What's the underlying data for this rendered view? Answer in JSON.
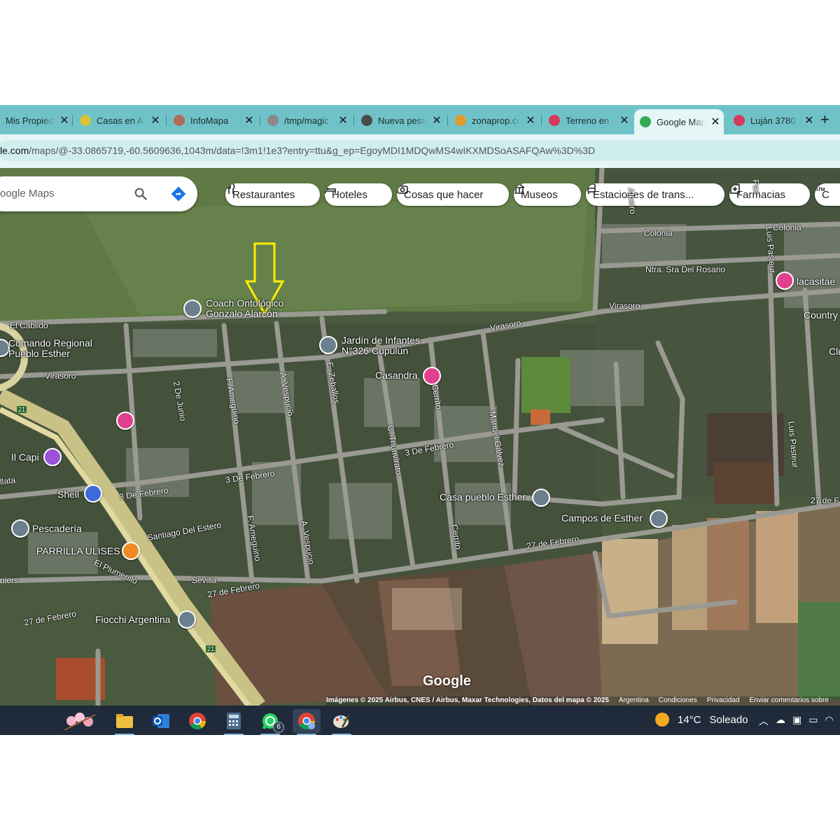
{
  "browser": {
    "tabs": [
      {
        "title": "Mis Propiedades",
        "favicon": "house-icon",
        "color": "#2a8a8f"
      },
      {
        "title": "Casas en Alquiler",
        "favicon": "home-icon",
        "color": "#d8c33a"
      },
      {
        "title": "InfoMapa",
        "favicon": "globe-icon",
        "color": "#b06a5a"
      },
      {
        "title": "/tmp/magic",
        "favicon": "page-icon",
        "color": "#8a8a8a"
      },
      {
        "title": "Nueva pestaña",
        "favicon": "chrome-icon",
        "color": "#4a4a4a"
      },
      {
        "title": "zonaprop.com.ar",
        "favicon": "key-icon",
        "color": "#e09b2a"
      },
      {
        "title": "Terreno en venta",
        "favicon": "shield-icon",
        "color": "#d63a5a"
      },
      {
        "title": "Google Maps",
        "favicon": "maps-pin-icon",
        "color": "#34a853",
        "active": true
      },
      {
        "title": "Luján 3780",
        "favicon": "shield-icon",
        "color": "#d63a5a"
      }
    ],
    "new_tab_label": "+",
    "url_domain": "le.com",
    "url_path": "/maps/@-33.0865719,-60.5609636,1043m/data=!3m1!1e3?entry=ttu&g_ep=EgoyMDI1MDQwMS4wIKXMDSoASAFQAw%3D%3D"
  },
  "map": {
    "search_placeholder": "oogle Maps",
    "chips": [
      {
        "label": "Restaurantes",
        "icon": "fork-knife-icon"
      },
      {
        "label": "Hoteles",
        "icon": "bed-icon"
      },
      {
        "label": "Cosas que hacer",
        "icon": "camera-icon"
      },
      {
        "label": "Museos",
        "icon": "museum-icon"
      },
      {
        "label": "Estaciones de trans...",
        "icon": "train-icon"
      },
      {
        "label": "Farmacias",
        "icon": "pharmacy-icon"
      },
      {
        "label": "C",
        "icon": "atm-icon"
      }
    ],
    "places": [
      {
        "name": "Coach Ontológico\nGonzalo Alarcón",
        "pin": "gray"
      },
      {
        "name": "Jardín de Infantes\nN°326 Cupulún",
        "pin": "gray"
      },
      {
        "name": "Casandra",
        "pin": "pink"
      },
      {
        "name": "Comando Regional\nPueblo Esther",
        "pin": "gray"
      },
      {
        "name": "Il Capi",
        "pin": "purple"
      },
      {
        "name": "Shell",
        "pin": "blue"
      },
      {
        "name": "Pescadería",
        "pin": "gray"
      },
      {
        "name": "PARRILLA ULISES",
        "pin": "orange"
      },
      {
        "name": "Fiocchi Argentina",
        "pin": "gray"
      },
      {
        "name": "Casa pueblo Esther",
        "pin": "gray"
      },
      {
        "name": "Campos de Esther",
        "pin": "gray"
      },
      {
        "name": "lacasitae",
        "pin": "pink"
      }
    ],
    "streets": [
      "El Cabildo",
      "Virasoro",
      "Virasoro",
      "Virasoro",
      "Colonia",
      "Colonia",
      "Ntra. Sra Del Rosario",
      "Country",
      "Clu",
      "2 De Junio",
      "F. Ameguino",
      "A. Vespucio",
      "E. Zeballos",
      "C. Triunvirato",
      "Cerrito",
      "Manuel Gálvez",
      "3 De Febrero",
      "3 De Febrero",
      "3 De Febrero",
      "F. Ameguino",
      "A. Vespucio",
      "Santiago Del Estero",
      "Sevilla",
      "El Plumerillo",
      "27 de Febrero",
      "27 de Febrero",
      "27 de Febrero",
      "Cerrito",
      "Luis Pasteur",
      "Luis Pasteur",
      "27 de F",
      "llata",
      "niers",
      "Pas",
      "Alpeiro",
      "21",
      "21"
    ],
    "logo": "Google",
    "attribution": [
      "Imágenes © 2025 Airbus, CNES / Airbus, Maxar Technologies, Datos del mapa © 2025",
      "Argentina",
      "Condiciones",
      "Privacidad",
      "Enviar comentarios sobre"
    ]
  },
  "taskbar": {
    "apps": [
      "blossom-icon",
      "file-explorer-icon",
      "outlook-icon",
      "chrome-icon",
      "calculator-icon",
      "whatsapp-icon",
      "chrome-profile-icon",
      "paint-icon"
    ],
    "whatsapp_badge": "6",
    "weather_temp": "14°C",
    "weather_text": "Soleado"
  }
}
